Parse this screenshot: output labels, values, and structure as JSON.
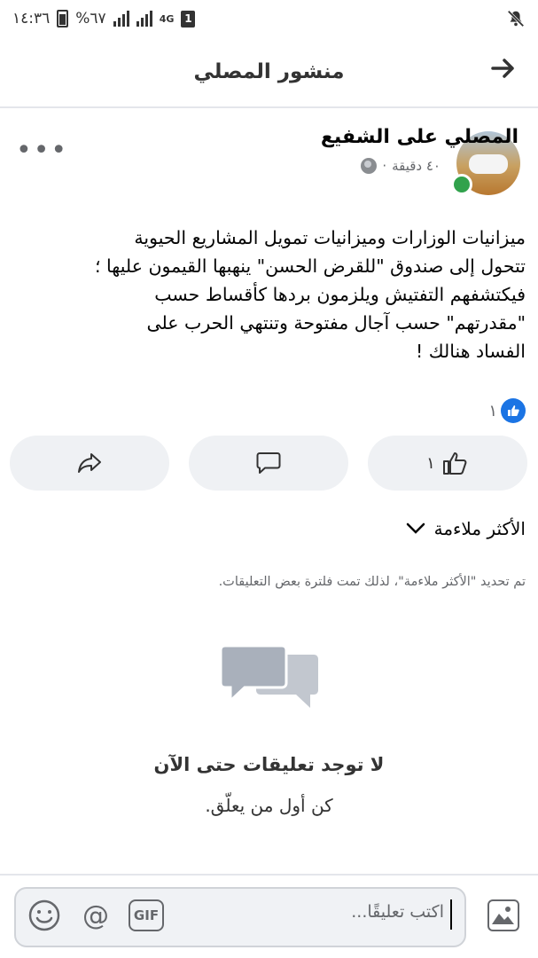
{
  "status_bar": {
    "time": "١٤:٣٦",
    "battery": "%٦٧",
    "network": "4G",
    "sim": "1"
  },
  "header": {
    "title": "منشور المصلي",
    "back_icon": "arrow-right-icon"
  },
  "post": {
    "author": "المصلي على الشفيع",
    "time": "٤٠ دقيقة",
    "separator": "·",
    "privacy_icon": "globe-icon",
    "more_icon": "more-dots-icon",
    "text": "ميزانيات الوزارات وميزانيات تمويل المشاريع الحيوية\nتتحول إلى صندوق \"للقرض الحسن\" ينهبها القيمون عليها ؛\nفيكتشفهم التفتيش ويلزمون بردها كأقساط حسب\n\"مقدرتهم\" حسب آجال مفتوحة  وتنتهي الحرب على\nالفساد هنالك !",
    "reaction_count": "١"
  },
  "actions": {
    "like_count": "١",
    "like_icon": "thumbs-up-icon",
    "comment_icon": "comment-bubble-icon",
    "share_icon": "share-arrow-icon"
  },
  "comments": {
    "sort_label": "الأكثر ملاءمة",
    "filter_note": "تم تحديد \"الأكثر ملاءمة\"، لذلك تمت فلترة بعض التعليقات.",
    "empty_title": "لا توجد تعليقات حتى الآن",
    "empty_subtitle": "كن أول من يعلّق."
  },
  "composer": {
    "placeholder": "اكتب تعليقًا...",
    "gif_label": "GIF",
    "at_label": "@"
  },
  "colors": {
    "accent": "#1b74e4",
    "online": "#31a24c",
    "button_bg": "#eff1f4",
    "muted_text": "#65676b"
  }
}
